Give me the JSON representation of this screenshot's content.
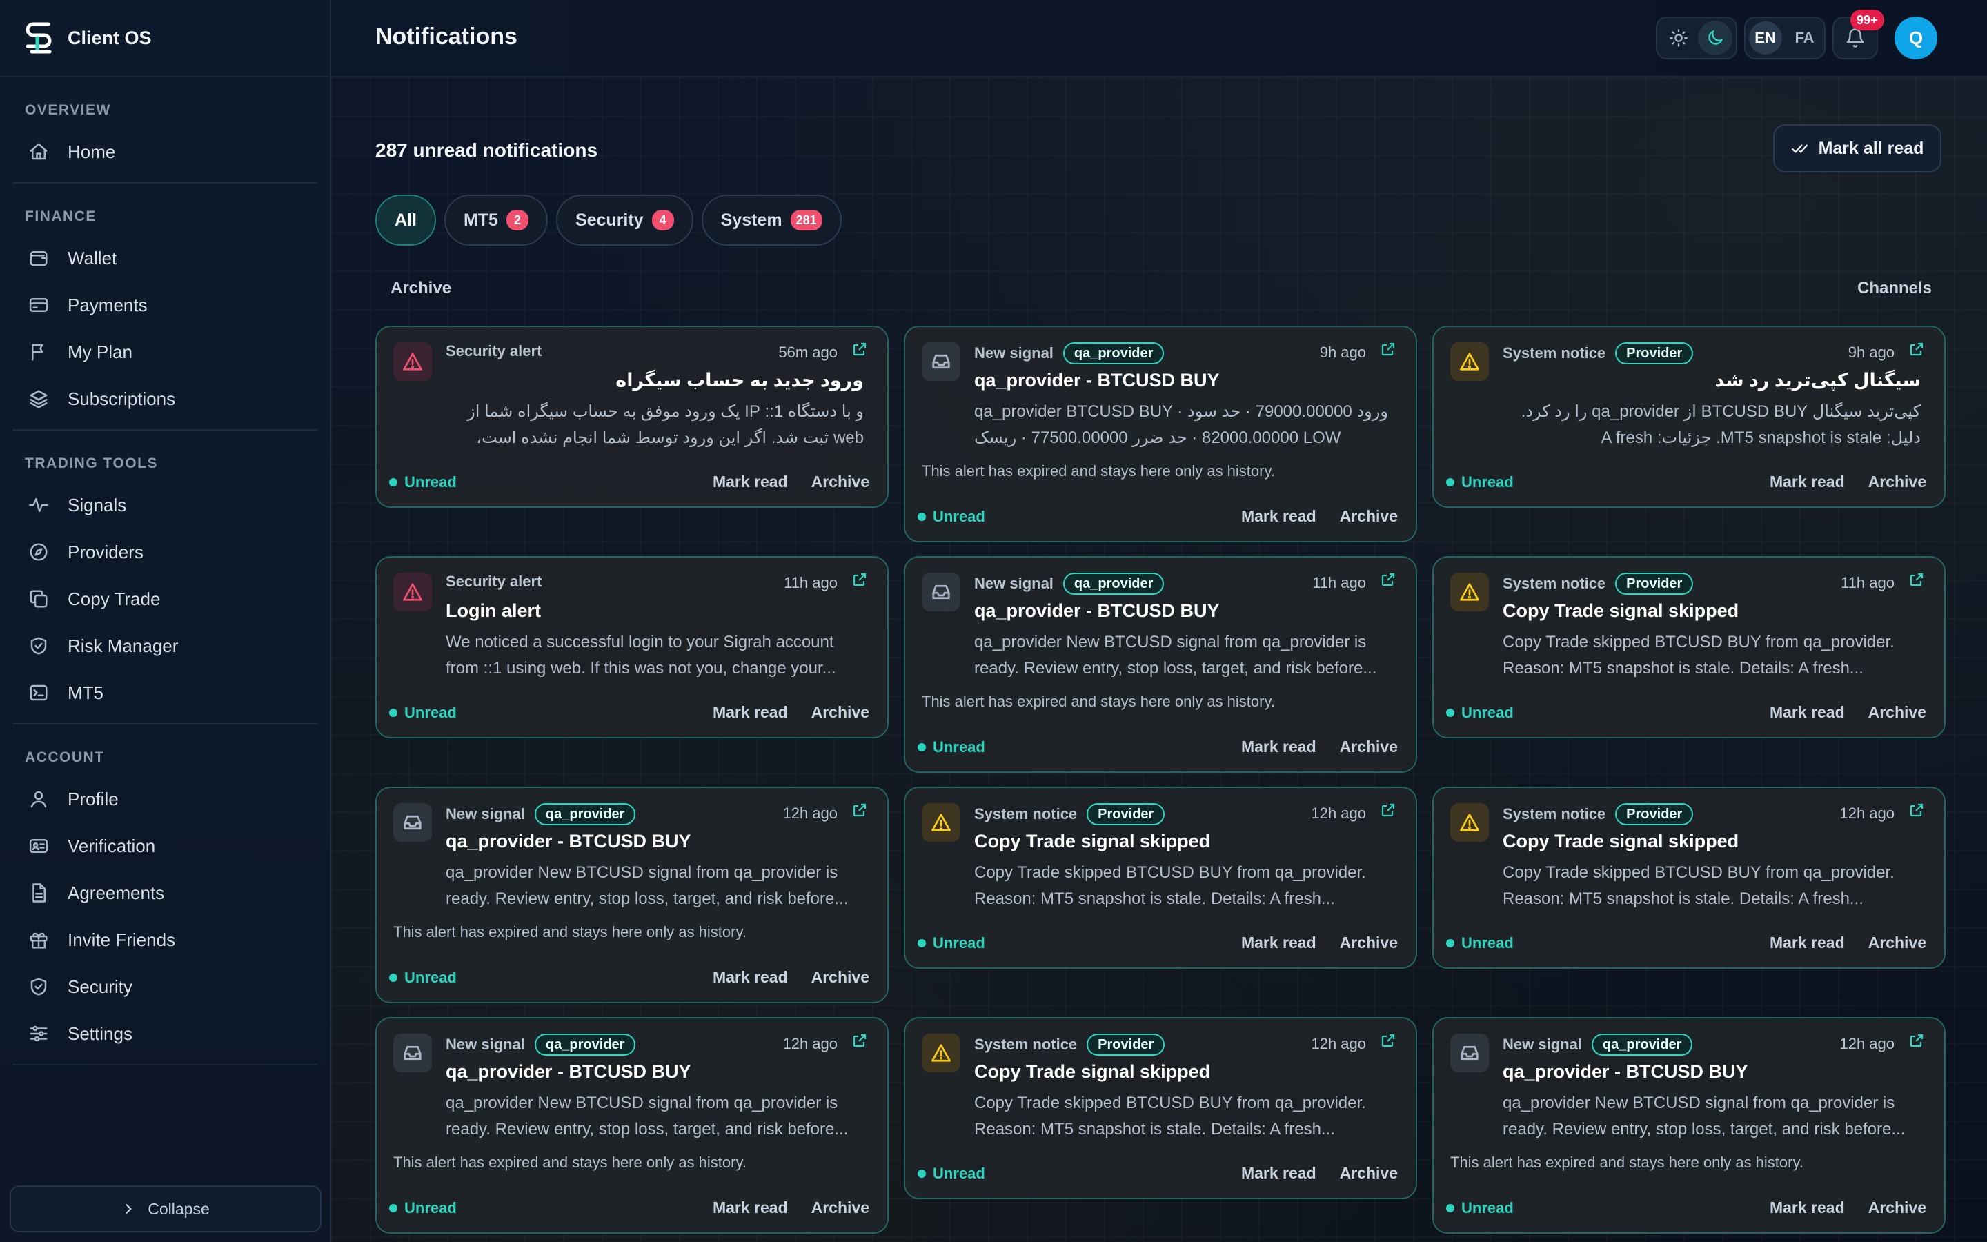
{
  "app": {
    "name": "Client OS"
  },
  "sidebar": {
    "sections": [
      {
        "heading": "OVERVIEW",
        "items": [
          {
            "label": "Home",
            "icon": "home-icon"
          }
        ]
      },
      {
        "heading": "FINANCE",
        "items": [
          {
            "label": "Wallet",
            "icon": "wallet-icon"
          },
          {
            "label": "Payments",
            "icon": "credit-card-icon"
          },
          {
            "label": "My Plan",
            "icon": "flag-icon"
          },
          {
            "label": "Subscriptions",
            "icon": "layers-icon"
          }
        ]
      },
      {
        "heading": "TRADING TOOLS",
        "items": [
          {
            "label": "Signals",
            "icon": "activity-icon"
          },
          {
            "label": "Providers",
            "icon": "compass-icon"
          },
          {
            "label": "Copy Trade",
            "icon": "copy-icon"
          },
          {
            "label": "Risk Manager",
            "icon": "shield-check-icon"
          },
          {
            "label": "MT5",
            "icon": "terminal-icon"
          }
        ]
      },
      {
        "heading": "ACCOUNT",
        "items": [
          {
            "label": "Profile",
            "icon": "user-icon"
          },
          {
            "label": "Verification",
            "icon": "id-card-icon"
          },
          {
            "label": "Agreements",
            "icon": "document-icon"
          },
          {
            "label": "Invite Friends",
            "icon": "gift-icon"
          },
          {
            "label": "Security",
            "icon": "shield-check-icon"
          },
          {
            "label": "Settings",
            "icon": "sliders-icon"
          }
        ]
      }
    ],
    "collapse_label": "Collapse"
  },
  "header": {
    "title": "Notifications",
    "lang_en": "EN",
    "lang_fa": "FA",
    "notif_badge": "99+",
    "avatar_initial": "Q"
  },
  "main": {
    "unread_count": "287 unread notifications",
    "mark_all_label": "Mark all read",
    "filters": [
      {
        "label": "All",
        "badge": ""
      },
      {
        "label": "MT5",
        "badge": "2"
      },
      {
        "label": "Security",
        "badge": "4"
      },
      {
        "label": "System",
        "badge": "281"
      }
    ],
    "archive_label": "Archive",
    "channels_label": "Channels",
    "unread_label": "Unread",
    "mark_read_label": "Mark read",
    "archive_action_label": "Archive",
    "expired_text": "This alert has expired and stays here only as history.",
    "cards": [
      {
        "kind": "security",
        "type": "Security alert",
        "tag": "",
        "time": "56m ago",
        "title": "ورود جدید به حساب سیگراه",
        "rtl": true,
        "body": "و با دستگاه 1:: IP یک ورود موفق به حساب سیگراه شما از web ثبت شد. اگر این ورود توسط شما انجام نشده است، فوراً...",
        "expired": false
      },
      {
        "kind": "signal",
        "type": "New signal",
        "tag": "qa_provider",
        "time": "9h ago",
        "title": "qa_provider - BTCUSD BUY",
        "rtl": false,
        "body": "qa_provider BTCUSD BUY · ورود 79000.00000 · حد سود 82000.00000 · حد ضرر 77500.00000 · ریسک LOW",
        "expired": true
      },
      {
        "kind": "system",
        "type": "System notice",
        "tag": "Provider",
        "time": "9h ago",
        "title": "سیگنال کپی‌ترید رد شد",
        "rtl": true,
        "body": "کپی‌ترید سیگنال BTCUSD BUY از qa_provider را رد کرد. دلیل: MT5 snapshot is stale. جزئیات: A fresh authenticated...",
        "expired": false
      },
      {
        "kind": "security",
        "type": "Security alert",
        "tag": "",
        "time": "11h ago",
        "title": "Login alert",
        "rtl": false,
        "body": "We noticed a successful login to your Sigrah account from ::1 using web. If this was not you, change your...",
        "expired": false
      },
      {
        "kind": "signal",
        "type": "New signal",
        "tag": "qa_provider",
        "time": "11h ago",
        "title": "qa_provider - BTCUSD BUY",
        "rtl": false,
        "body": "qa_provider New BTCUSD signal from qa_provider is ready. Review entry, stop loss, target, and risk before...",
        "expired": true
      },
      {
        "kind": "system",
        "type": "System notice",
        "tag": "Provider",
        "time": "11h ago",
        "title": "Copy Trade signal skipped",
        "rtl": false,
        "body": "Copy Trade skipped BTCUSD BUY from qa_provider. Reason: MT5 snapshot is stale. Details: A fresh...",
        "expired": false
      },
      {
        "kind": "signal",
        "type": "New signal",
        "tag": "qa_provider",
        "time": "12h ago",
        "title": "qa_provider - BTCUSD BUY",
        "rtl": false,
        "body": "qa_provider New BTCUSD signal from qa_provider is ready. Review entry, stop loss, target, and risk before...",
        "expired": true
      },
      {
        "kind": "system",
        "type": "System notice",
        "tag": "Provider",
        "time": "12h ago",
        "title": "Copy Trade signal skipped",
        "rtl": false,
        "body": "Copy Trade skipped BTCUSD BUY from qa_provider. Reason: MT5 snapshot is stale. Details: A fresh...",
        "expired": false
      },
      {
        "kind": "system",
        "type": "System notice",
        "tag": "Provider",
        "time": "12h ago",
        "title": "Copy Trade signal skipped",
        "rtl": false,
        "body": "Copy Trade skipped BTCUSD BUY from qa_provider. Reason: MT5 snapshot is stale. Details: A fresh...",
        "expired": false
      },
      {
        "kind": "signal",
        "type": "New signal",
        "tag": "qa_provider",
        "time": "12h ago",
        "title": "qa_provider - BTCUSD BUY",
        "rtl": false,
        "body": "qa_provider New BTCUSD signal from qa_provider is ready. Review entry, stop loss, target, and risk before...",
        "expired": true
      },
      {
        "kind": "system",
        "type": "System notice",
        "tag": "Provider",
        "time": "12h ago",
        "title": "Copy Trade signal skipped",
        "rtl": false,
        "body": "Copy Trade skipped BTCUSD BUY from qa_provider. Reason: MT5 snapshot is stale. Details: A fresh...",
        "expired": false
      },
      {
        "kind": "signal",
        "type": "New signal",
        "tag": "qa_provider",
        "time": "12h ago",
        "title": "qa_provider - BTCUSD BUY",
        "rtl": false,
        "body": "qa_provider New BTCUSD signal from qa_provider is ready. Review entry, stop loss, target, and risk before...",
        "expired": true
      }
    ]
  },
  "colors": {
    "accent": "#2dd4bf",
    "danger": "#f0506e",
    "warning": "#facc15",
    "avatar": "#0ea5e9"
  }
}
